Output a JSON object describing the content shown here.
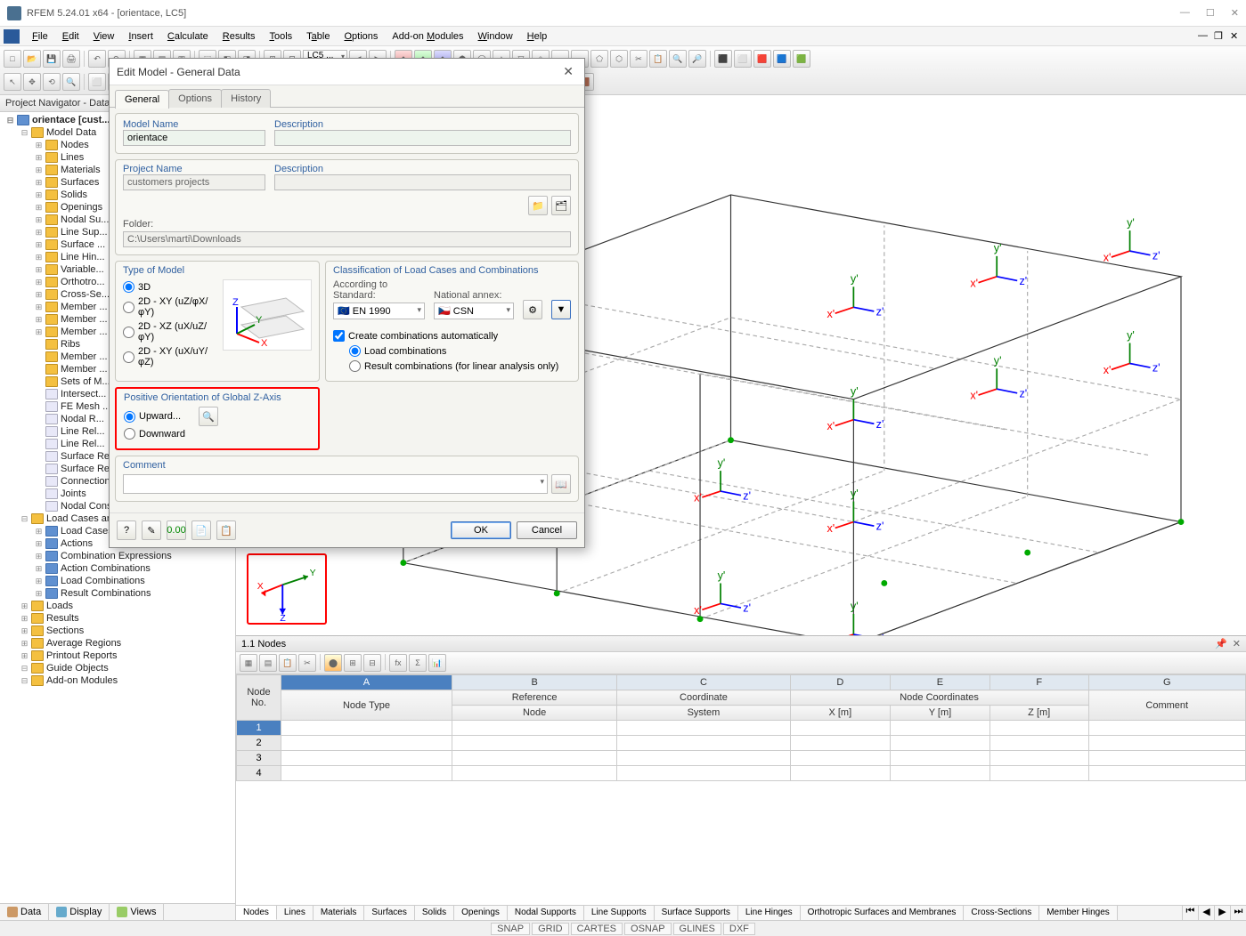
{
  "window": {
    "title": "RFEM 5.24.01 x64 - [orientace, LC5]"
  },
  "menu": {
    "items": [
      "File",
      "Edit",
      "View",
      "Insert",
      "Calculate",
      "Results",
      "Tools",
      "Table",
      "Options",
      "Add-on Modules",
      "Window",
      "Help"
    ]
  },
  "navigator": {
    "title": "Project Navigator - Data",
    "root": "orientace [cust...",
    "model_data": "Model Data",
    "items1": [
      "Nodes",
      "Lines",
      "Materials",
      "Surfaces",
      "Solids",
      "Openings",
      "Nodal Su...",
      "Line Sup...",
      "Surface ...",
      "Line Hin...",
      "Variable...",
      "Orthotro...",
      "Cross-Se...",
      "Member ...",
      "Member ...",
      "Member ...",
      "Ribs",
      "Member ...",
      "Member ...",
      "Sets of M...",
      "Intersect...",
      "FE Mesh ...",
      "Nodal R...",
      "Line Rel...",
      "Line Rel...",
      "Surface Release Types",
      "Surface Releases",
      "Connection of Two Members",
      "Joints",
      "Nodal Constraints"
    ],
    "lcc": "Load Cases and Combinations",
    "items2": [
      "Load Cases",
      "Actions",
      "Combination Expressions",
      "Action Combinations",
      "Load Combinations",
      "Result Combinations"
    ],
    "items3": [
      "Loads",
      "Results",
      "Sections",
      "Average Regions",
      "Printout Reports",
      "Guide Objects",
      "Add-on Modules"
    ],
    "footer": [
      "Data",
      "Display",
      "Views"
    ]
  },
  "dialog": {
    "title": "Edit Model - General Data",
    "tabs": [
      "General",
      "Options",
      "History"
    ],
    "model_name_label": "Model Name",
    "model_name": "orientace",
    "description_label": "Description",
    "description": "",
    "project_name_label": "Project Name",
    "project_name": "customers projects",
    "proj_description_label": "Description",
    "proj_description": "",
    "folder_label": "Folder:",
    "folder": "C:\\Users\\marti\\Downloads",
    "type_of_model_label": "Type of Model",
    "type_3d": "3D",
    "type_2d_xy1": "2D - XY (uZ/φX/φY)",
    "type_2d_xz": "2D - XZ (uX/uZ/φY)",
    "type_2d_xy2": "2D - XY (uX/uY/φZ)",
    "classification_label": "Classification of Load Cases and Combinations",
    "according_label": "According to Standard:",
    "standard": "EN 1990",
    "annex_label": "National annex:",
    "annex": "CSN",
    "create_combo": "Create combinations automatically",
    "load_combo": "Load combinations",
    "result_combo": "Result combinations (for linear analysis only)",
    "orientation_label": "Positive Orientation of Global Z-Axis",
    "upward": "Upward...",
    "downward": "Downward",
    "comment_label": "Comment",
    "comment": "",
    "ok": "OK",
    "cancel": "Cancel"
  },
  "bottom_panel": {
    "title": "1.1 Nodes",
    "col_letters": [
      "A",
      "B",
      "C",
      "D",
      "E",
      "F",
      "G"
    ],
    "header1_node": "Node",
    "header1_no": "No.",
    "header_node_type": "Node Type",
    "header_ref_node": "Reference Node",
    "header_coord_sys": "Coordinate System",
    "header_node_coords": "Node Coordinates",
    "header_x": "X [m]",
    "header_y": "Y [m]",
    "header_z": "Z [m]",
    "header_comment": "Comment",
    "rows": [
      "1",
      "2",
      "3",
      "4"
    ],
    "tabs": [
      "Nodes",
      "Lines",
      "Materials",
      "Surfaces",
      "Solids",
      "Openings",
      "Nodal Supports",
      "Line Supports",
      "Surface Supports",
      "Line Hinges",
      "Orthotropic Surfaces and Membranes",
      "Cross-Sections",
      "Member Hinges"
    ]
  },
  "statusbar": {
    "items": [
      "SNAP",
      "GRID",
      "CARTES",
      "OSNAP",
      "GLINES",
      "DXF"
    ]
  }
}
